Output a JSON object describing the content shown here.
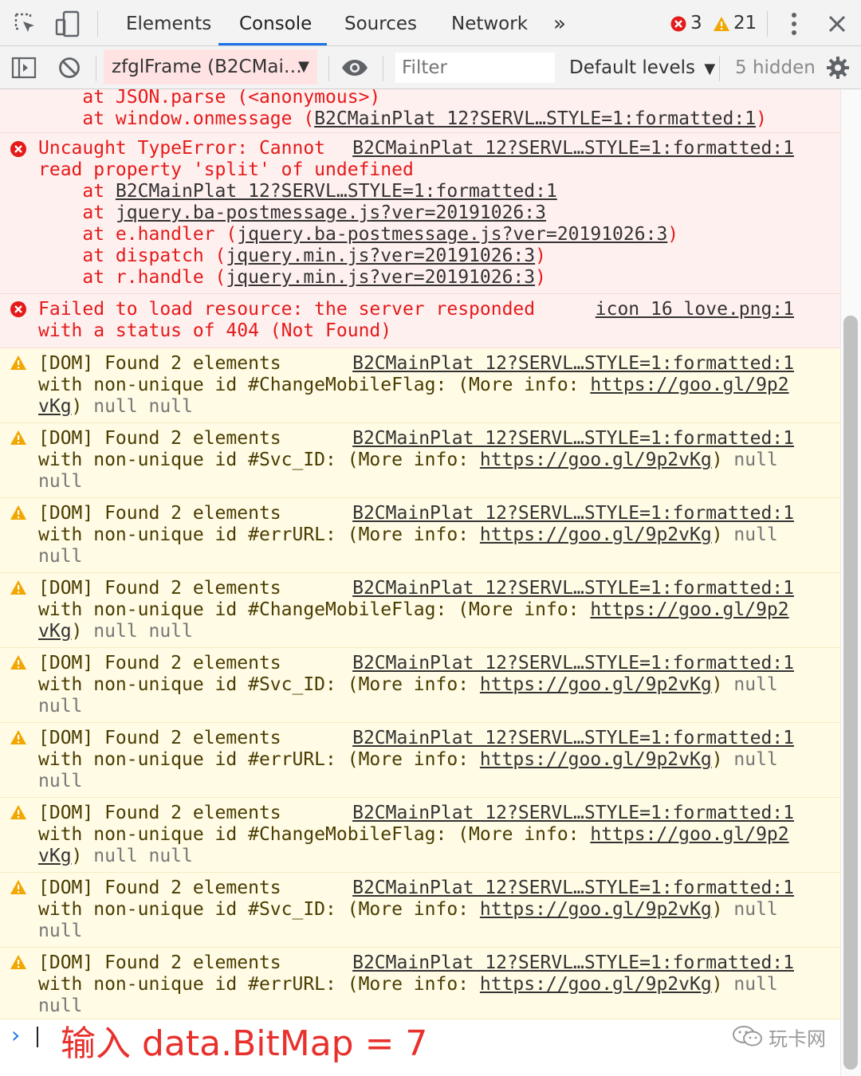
{
  "toolbar": {
    "tabs": [
      "Elements",
      "Console",
      "Sources",
      "Network"
    ],
    "more_tabs": "»",
    "error_count": "3",
    "warning_count": "21"
  },
  "console_toolbar": {
    "context": "zfglFrame (B2CMai…",
    "filter_placeholder": "Filter",
    "levels": "Default levels",
    "hidden": "5 hidden"
  },
  "messages": {
    "partial_error": {
      "line1": "    at JSON.parse (<anonymous>)",
      "line2_prefix": "    at window.onmessage (",
      "line2_link": "B2CMainPlat 12?SERVL…STYLE=1:formatted:1",
      "line2_suffix": ")"
    },
    "type_error": {
      "line1": "Uncaught TypeError: Cannot",
      "source": "B2CMainPlat 12?SERVL…STYLE=1:formatted:1",
      "line2": "read property 'split' of undefined",
      "at1_prefix": "    at ",
      "at1_link": "B2CMainPlat 12?SERVL…STYLE=1:formatted:1",
      "at2_link": "jquery.ba-postmessage.js?ver=20191026:3",
      "at3_prefix": "    at e.handler (",
      "at3_link": "jquery.ba-postmessage.js?ver=20191026:3",
      "at4_prefix": "    at dispatch (",
      "at4_link": "jquery.min.js?ver=20191026:3",
      "at5_prefix": "    at r.handle (",
      "at5_link": "jquery.min.js?ver=20191026:3",
      "close": ")"
    },
    "load_error": {
      "line1": "Failed to load resource: the server responded",
      "source": "icon 16 love.png:1",
      "line2": "with a status of 404 (Not Found)"
    },
    "warning_prefix": "[DOM] Found 2 elements",
    "warning_source": "B2CMainPlat 12?SERVL…STYLE=1:formatted:1",
    "warn_changemobile_line2": "with non-unique id #ChangeMobileFlag: (More info: ",
    "warn_changemobile_link_a": "https://goo.gl/9p2",
    "warn_changemobile_link_b": "vKg",
    "warn_changemobile_tail": ") ",
    "null_null": "null null",
    "warn_svc_line2": "with non-unique id #Svc_ID: (More info: ",
    "warn_err_line2": "with non-unique id #errURL: (More info: ",
    "info_link": "https://goo.gl/9p2vKg",
    "info_close": ") ",
    "null_word": "null"
  },
  "prompt": {
    "symbol": "›",
    "input": "输入 data.BitMap = 7"
  },
  "watermark": "玩卡网",
  "colors": {
    "error_bg": "#fff0f0",
    "error_text": "#e51a1a",
    "warning_bg": "#fffbe5",
    "accent": "#1a73e8"
  }
}
